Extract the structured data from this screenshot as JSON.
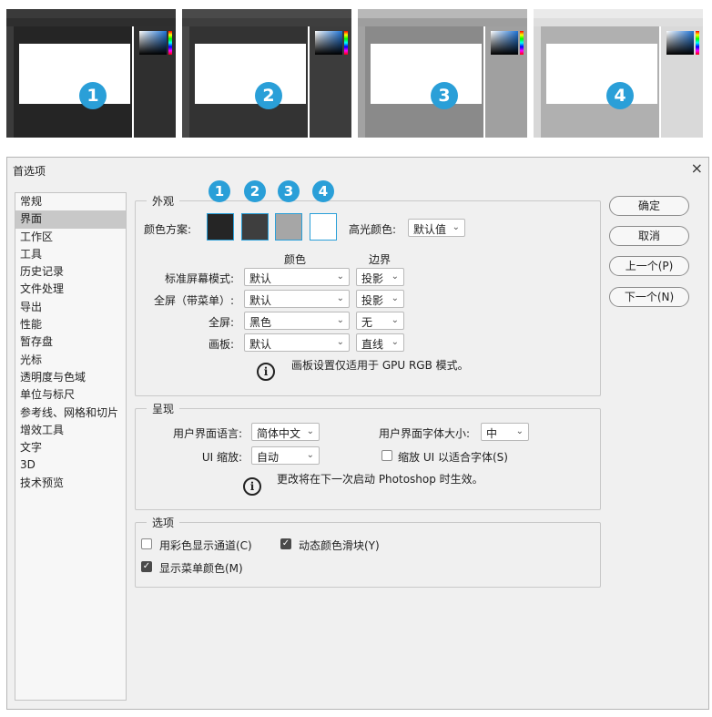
{
  "thumbnails": [
    {
      "number": "1"
    },
    {
      "number": "2"
    },
    {
      "number": "3"
    },
    {
      "number": "4"
    }
  ],
  "colors": {
    "accent": "#2a9fd8",
    "swatch1": "#252525",
    "swatch2": "#3e3e3e",
    "swatch3": "#a6a6a6",
    "swatch4": "#ffffff"
  },
  "dialog": {
    "title": "首选项",
    "close": "×"
  },
  "sidebar": {
    "items": [
      "常规",
      "界面",
      "工作区",
      "工具",
      "历史记录",
      "文件处理",
      "导出",
      "性能",
      "暂存盘",
      "光标",
      "透明度与色域",
      "单位与标尺",
      "参考线、网格和切片",
      "增效工具",
      "文字",
      "3D",
      "技术预览"
    ]
  },
  "appearance": {
    "legend": "外观",
    "color_scheme_label": "颜色方案:",
    "highlight_label": "高光颜色:",
    "highlight_value": "默认值",
    "col_color": "颜色",
    "col_border": "边界",
    "rows": [
      {
        "label": "标准屏幕模式:",
        "color": "默认",
        "border": "投影"
      },
      {
        "label": "全屏（带菜单）:",
        "color": "默认",
        "border": "投影"
      },
      {
        "label": "全屏:",
        "color": "黑色",
        "border": "无"
      },
      {
        "label": "画板:",
        "color": "默认",
        "border": "直线"
      }
    ],
    "note": "画板设置仅适用于 GPU RGB 模式。"
  },
  "presentation": {
    "legend": "呈现",
    "ui_lang_label": "用户界面语言:",
    "ui_lang_value": "简体中文",
    "font_size_label": "用户界面字体大小:",
    "font_size_value": "中",
    "ui_scale_label": "UI 缩放:",
    "ui_scale_value": "自动",
    "scale_font_label": "缩放 UI 以适合字体(S)",
    "note": "更改将在下一次启动 Photoshop 时生效。"
  },
  "options": {
    "legend": "选项",
    "color_channels_label": "用彩色显示通道(C)",
    "dynamic_sliders_label": "动态颜色滑块(Y)",
    "menu_colors_label": "显示菜单颜色(M)"
  },
  "buttons": {
    "ok": "确定",
    "cancel": "取消",
    "prev": "上一个(P)",
    "next": "下一个(N)"
  }
}
